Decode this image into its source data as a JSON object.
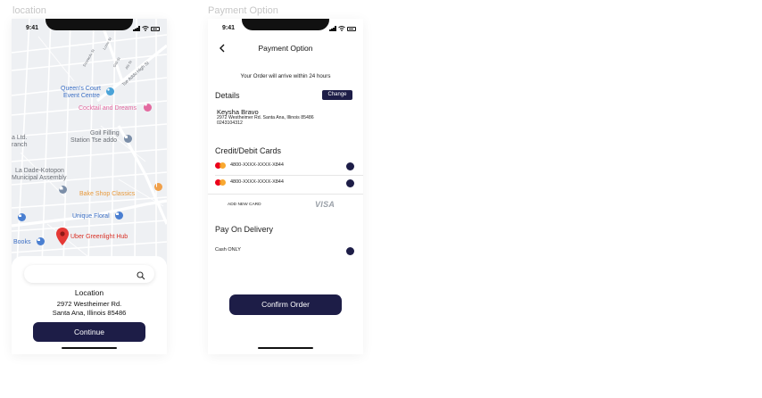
{
  "frames": {
    "location_label": "location",
    "payment_label": "Payment Option"
  },
  "status_bar": {
    "time": "9:41"
  },
  "map": {
    "streets": [
      "Tse Addo High St",
      "Lomo St",
      "Gidi St",
      "Abi St",
      "Dzorwulu St"
    ],
    "places": [
      {
        "name": "Queen's Court",
        "line2": "Event Centre",
        "color": "#3c6fc4"
      },
      {
        "name": "Cocktail and Dreams",
        "color": "#e36aa0"
      },
      {
        "name": "Goil Filling",
        "line2": "Station Tse addo",
        "color": "#6b6f76"
      },
      {
        "name": "a Ltd.",
        "line2": "ranch",
        "color": "#6b6f76"
      },
      {
        "name": "La Dade-Kotopon",
        "line2": "Municipal Assembly",
        "color": "#6b6f76"
      },
      {
        "name": "Bake Shop Classics",
        "color": "#e89a3c"
      },
      {
        "name": "Unique Floral",
        "color": "#3c6fc4"
      },
      {
        "name": "Uber Greenlight Hub",
        "color": "#d93025"
      },
      {
        "name": "Books",
        "color": "#3c6fc4"
      }
    ]
  },
  "location_sheet": {
    "search_placeholder": "",
    "title": "Location",
    "address_line1": "2972 Westheimer Rd.",
    "address_line2": "Santa Ana, Illinois 85486",
    "continue_label": "Continue"
  },
  "payment": {
    "title": "Payment Option",
    "arrival_note": "Your Order will arrive within 24 hours",
    "details_heading": "Details",
    "change_label": "Change",
    "customer_name": "Keysha Bravo",
    "customer_address": "2972 Westheimer Rd. Santa Ana, Illinois 85486",
    "customer_phone": "0243104312",
    "cards_heading": "Credit/Debit Cards",
    "cards": [
      {
        "number": "4800-XXXX-XXXX-X844"
      },
      {
        "number": "4800-XXXX-XXXX-X844"
      }
    ],
    "add_card_label": "ADD NEW CARD",
    "visa_label": "VISA",
    "delivery_heading": "Pay On Delivery",
    "cash_label": "Cash ONLY",
    "confirm_label": "Confirm Order"
  },
  "colors": {
    "primary": "#1d1d47",
    "map_background": "#eef0f3"
  }
}
